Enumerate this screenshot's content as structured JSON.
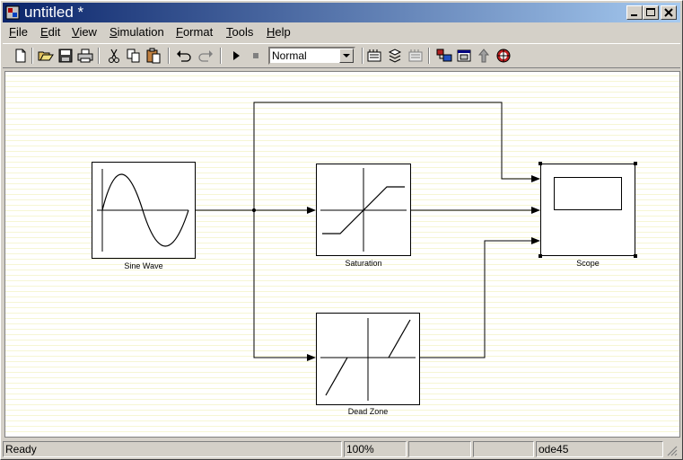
{
  "window": {
    "title": "untitled *"
  },
  "title_buttons": [
    "minimize",
    "maximize",
    "close"
  ],
  "menu": [
    {
      "label": "File"
    },
    {
      "label": "Edit"
    },
    {
      "label": "View"
    },
    {
      "label": "Simulation"
    },
    {
      "label": "Format"
    },
    {
      "label": "Tools"
    },
    {
      "label": "Help"
    }
  ],
  "toolbar": {
    "icons": [
      "new-icon",
      "open-icon",
      "save-icon",
      "print-icon",
      "cut-icon",
      "copy-icon",
      "paste-icon",
      "undo-icon",
      "redo-icon",
      "start-icon",
      "stop-icon",
      "build-icon",
      "update-icon",
      "library-icon",
      "model-browser-icon",
      "parent-icon",
      "debug-icon"
    ],
    "sim_mode": "Normal"
  },
  "blocks": {
    "sine": "Sine Wave",
    "saturation": "Saturation",
    "deadzone": "Dead Zone",
    "scope": "Scope"
  },
  "status": {
    "message": "Ready",
    "zoom": "100%",
    "blank1": "",
    "blank2": "",
    "solver": "ode45"
  }
}
